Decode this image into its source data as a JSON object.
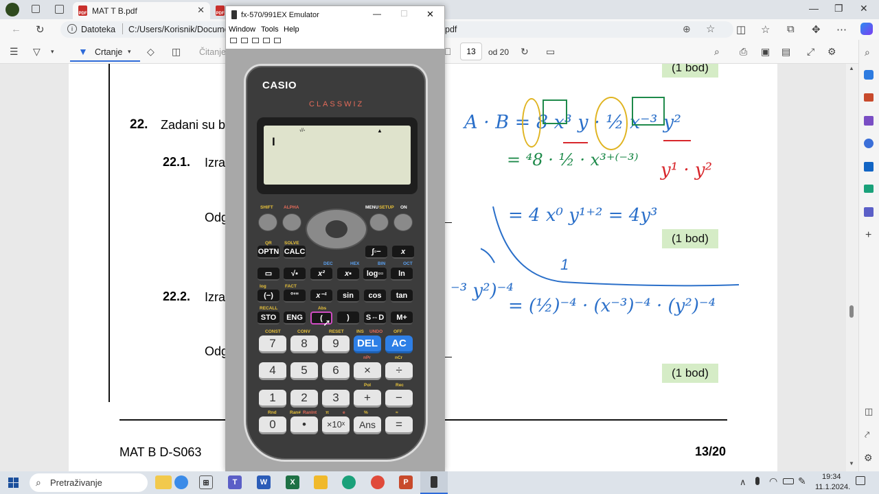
{
  "browser": {
    "tabs": [
      {
        "label": "MAT T B.pdf"
      },
      {
        "label": "fx-570/991EX Emulator"
      }
    ],
    "address": {
      "scheme_label": "Datoteka",
      "url_prefix": "C:/Users/Korisnik/Documen",
      "url_suffix": "pdf"
    }
  },
  "pdf_toolbar": {
    "draw_label": "Crtanje",
    "read_label": "Čitanje",
    "page_number": "13",
    "page_total": "od 20"
  },
  "pdf_page": {
    "task22_number": "22.",
    "task22_text": "Zadani su b",
    "task22_1_number": "22.1.",
    "task22_1_text": "Izra",
    "answer_1": "Odg",
    "task22_2_number": "22.2.",
    "task22_2_text": "Izra",
    "answer_2": "Odg",
    "bod_label": "(1 bod)",
    "footer_left": "MAT B D-S063",
    "footer_right": "13/20",
    "handwriting": {
      "line1": "A · B = 8 x³ y · ½ x⁻³ y²",
      "line2": "= ⁴8 · ½ · x³⁺⁽⁻³⁾",
      "line2b": "y¹ · y²",
      "line3": "= 4 x⁰ y¹⁺² = 4y³",
      "line4a": "⁻³ y²)⁻⁴",
      "line4b": "= (½)⁻⁴ · (x⁻³)⁻⁴ · (y²)⁻⁴",
      "small_one": "1"
    }
  },
  "emulator": {
    "title": "fx-570/991EX Emulator",
    "menu": [
      "Window",
      "Tools",
      "Help"
    ],
    "brand": "CASIO",
    "model": "CLASSWIZ",
    "lcd_cursor": "I",
    "lcd_indicator": "√/▫",
    "lcd_arrow": "▲",
    "function_labels": {
      "shift": "SHIFT",
      "alpha": "ALPHA",
      "menu": "MENU",
      "setup": "SETUP",
      "on": "ON"
    },
    "rows": {
      "row1": [
        "OPTN",
        "CALC",
        "∫▫−",
        "x"
      ],
      "row2": [
        "▭",
        "√▪",
        "x²",
        "x▪",
        "log▫▫",
        "ln"
      ],
      "row3": [
        "(−)",
        "°'\"",
        "x⁻¹",
        "sin",
        "cos",
        "tan"
      ],
      "row4": [
        "STO",
        "ENG",
        "(",
        ")",
        "S⇔D",
        "M+"
      ],
      "row5": [
        "7",
        "8",
        "9",
        "DEL",
        "AC"
      ],
      "row6": [
        "4",
        "5",
        "6",
        "×",
        "÷"
      ],
      "row7": [
        "1",
        "2",
        "3",
        "+",
        "−"
      ],
      "row8": [
        "0",
        "•",
        "×10ˣ",
        "Ans",
        "="
      ]
    },
    "secondary": {
      "qr": "QR",
      "solve": "SOLVE",
      "fact": "FACT",
      "log": "log",
      "recall": "RECALL",
      "abs": "Abs",
      "const": "CONV",
      "const_label": "CONST",
      "reset": "RESET",
      "ins": "INS",
      "undo": "UNDO",
      "off": "OFF",
      "npr": "nPr",
      "ncr": "nCr",
      "pol": "Pol",
      "rec": "Rec",
      "rnd": "Rnd",
      "ran": "Ran#",
      "ranint": "RanInt",
      "pi": "π",
      "e": "e",
      "pct": "%",
      "approx": "≈",
      "dec": "DEC",
      "hex": "HEX",
      "bin": "BIN",
      "oct": "OCT"
    }
  },
  "taskbar": {
    "search_label": "Pretraživanje",
    "time": "19:34",
    "date": "11.1.2024."
  },
  "colors": {
    "accent_blue": "#2e7fe6",
    "bod_green": "#d5ecc6",
    "ink_blue": "#2a6fc9",
    "ink_green": "#1e8a4a",
    "ink_yellow": "#e0b421",
    "ink_red": "#d8262b"
  }
}
